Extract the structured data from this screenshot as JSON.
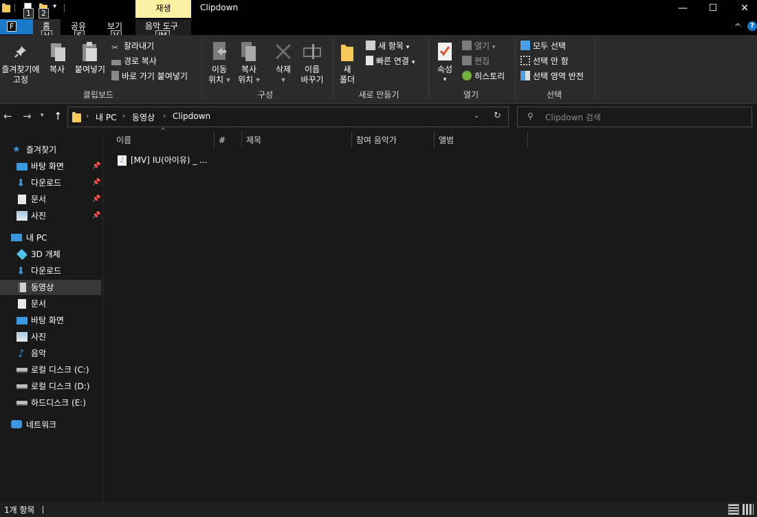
{
  "titlebar": {
    "window_title": "Clipdown",
    "context_tab": "재생",
    "keytips": [
      "1",
      "2"
    ],
    "controls": {
      "minimize": "—",
      "maximize": "☐",
      "close": "✕"
    }
  },
  "tabs": {
    "file": {
      "label": "F",
      "keytip": "F"
    },
    "items": [
      {
        "label": "홈",
        "keytip": "H"
      },
      {
        "label": "공유",
        "keytip": "S"
      },
      {
        "label": "보기",
        "keytip": "V"
      },
      {
        "label": "음악 도구",
        "keytip": "JM"
      }
    ],
    "collapse": "^",
    "help": "?"
  },
  "ribbon": {
    "clipboard": {
      "label": "클립보드",
      "pin_line1": "즐겨찾기에",
      "pin_line2": "고정",
      "copy": "복사",
      "paste": "붙여넣기",
      "cut": "잘라내기",
      "copy_path": "경로 복사",
      "paste_shortcut": "바로 가기 붙여넣기"
    },
    "organize": {
      "label": "구성",
      "move_line1": "이동",
      "move_line2": "위치",
      "copyto_line1": "복사",
      "copyto_line2": "위치",
      "delete": "삭제",
      "rename_line1": "이름",
      "rename_line2": "바꾸기"
    },
    "new": {
      "label": "새로 만들기",
      "folder_line1": "새",
      "folder_line2": "폴더",
      "new_item": "새 항목",
      "easy_access": "빠른 연결"
    },
    "open": {
      "label": "열기",
      "properties": "속성",
      "open": "열기",
      "edit": "편집",
      "history": "히스토리"
    },
    "select": {
      "label": "선택",
      "select_all": "모두 선택",
      "select_none": "선택 안 함",
      "invert": "선택 영역 반전"
    }
  },
  "address": {
    "crumbs": [
      "내 PC",
      "동영상",
      "Clipdown"
    ],
    "search_placeholder": "Clipdown 검색"
  },
  "sidebar": {
    "items": [
      {
        "label": "즐겨찾기"
      },
      {
        "label": "바탕 화면"
      },
      {
        "label": "다운로드"
      },
      {
        "label": "문서"
      },
      {
        "label": "사진"
      },
      {
        "label": "내 PC"
      },
      {
        "label": "3D 개체"
      },
      {
        "label": "다운로드"
      },
      {
        "label": "동영상"
      },
      {
        "label": "문서"
      },
      {
        "label": "바탕 화면"
      },
      {
        "label": "사진"
      },
      {
        "label": "음악"
      },
      {
        "label": "로컬 디스크 (C:)"
      },
      {
        "label": "로컬 디스크 (D:)"
      },
      {
        "label": "하드디스크 (E:)"
      },
      {
        "label": "네트워크"
      }
    ]
  },
  "columns": [
    "이름",
    "#",
    "제목",
    "참여 음악가",
    "앨범"
  ],
  "files": [
    {
      "name": "[MV] IU(아이유) _ ..."
    }
  ],
  "status": {
    "count": "1개 항목"
  },
  "colors": {
    "accent": "#1979ca",
    "context_tab": "#f9f0a0",
    "folder": "#f6c95b"
  }
}
